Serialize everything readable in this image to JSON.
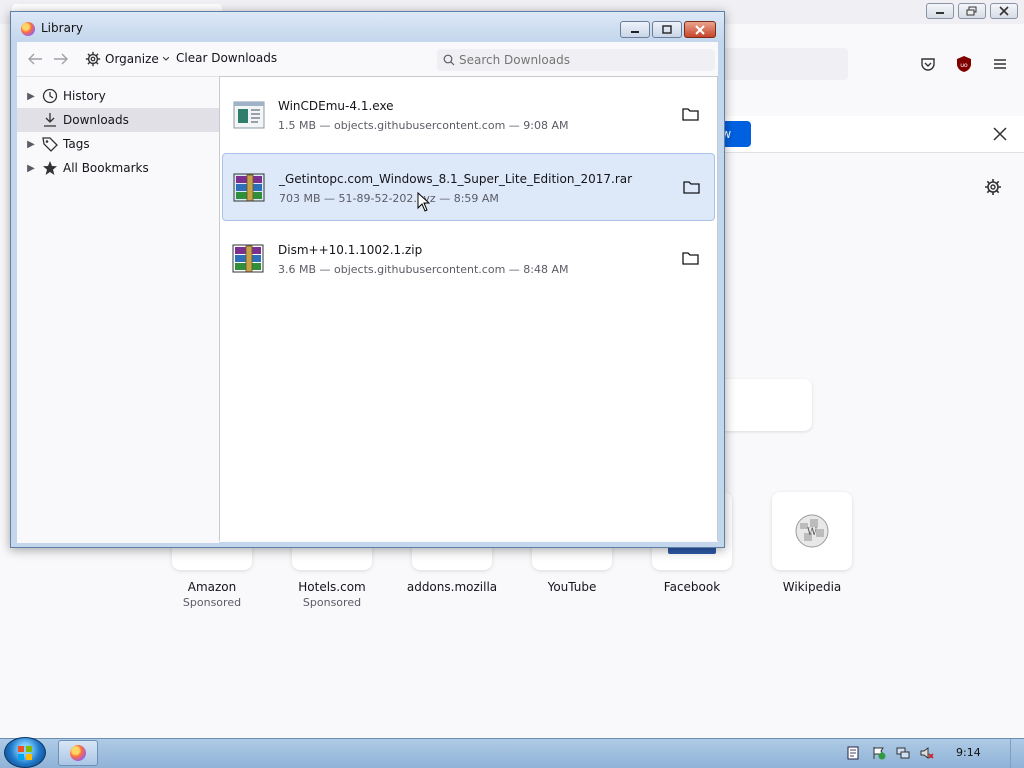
{
  "background": {
    "notification_button": "ow",
    "tiles": [
      {
        "label": "Amazon",
        "sub": "Sponsored"
      },
      {
        "label": "Hotels.com",
        "sub": "Sponsored"
      },
      {
        "label": "addons.mozilla",
        "sub": ""
      },
      {
        "label": "YouTube",
        "sub": ""
      },
      {
        "label": "Facebook",
        "sub": ""
      },
      {
        "label": "Wikipedia",
        "sub": ""
      }
    ]
  },
  "library": {
    "title": "Library",
    "toolbar": {
      "organize": "Organize",
      "clear_downloads": "Clear Downloads",
      "search_placeholder": "Search Downloads"
    },
    "sidebar": [
      {
        "label": "History",
        "icon": "clock-icon",
        "expandable": true,
        "selected": false
      },
      {
        "label": "Downloads",
        "icon": "download-icon",
        "expandable": false,
        "selected": true
      },
      {
        "label": "Tags",
        "icon": "tag-icon",
        "expandable": true,
        "selected": false
      },
      {
        "label": "All Bookmarks",
        "icon": "star-icon",
        "expandable": true,
        "selected": false
      }
    ],
    "downloads": [
      {
        "name": "WinCDEmu-4.1.exe",
        "meta": "1.5 MB — objects.githubusercontent.com — 9:08 AM",
        "icon": "exe-file-icon",
        "selected": false
      },
      {
        "name": "_Getintopc.com_Windows_8.1_Super_Lite_Edition_2017.rar",
        "meta": "703 MB — 51-89-52-202.xyz — 8:59 AM",
        "icon": "winrar-archive-icon",
        "selected": true
      },
      {
        "name": "Dism++10.1.1002.1.zip",
        "meta": "3.6 MB — objects.githubusercontent.com — 8:48 AM",
        "icon": "winrar-archive-icon",
        "selected": false
      }
    ]
  },
  "taskbar": {
    "clock": "9:14"
  },
  "colors": {
    "accent": "#0061e0",
    "selection": "#dde9f9"
  }
}
